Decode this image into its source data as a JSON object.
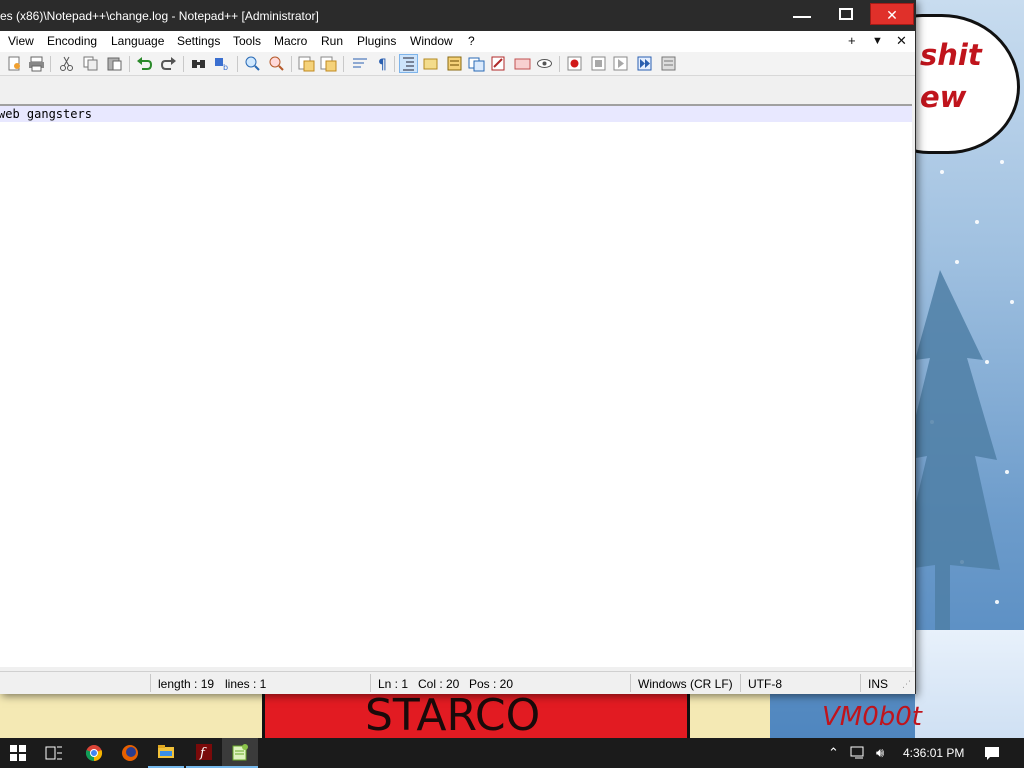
{
  "window": {
    "title": "es (x86)\\Notepad++\\change.log - Notepad++ [Administrator]"
  },
  "menu": {
    "items": [
      "View",
      "Encoding",
      "Language",
      "Settings",
      "Tools",
      "Macro",
      "Run",
      "Plugins",
      "Window",
      "?"
    ],
    "right": [
      "+",
      "▼",
      "✕"
    ]
  },
  "toolbar": {
    "icons": [
      "new-file-icon",
      "print-icon",
      "cut-icon",
      "copy-icon",
      "paste-icon",
      "undo-icon",
      "redo-icon",
      "find-icon",
      "replace-icon",
      "zoom-in-icon",
      "zoom-out-icon",
      "sync-v-icon",
      "sync-h-icon",
      "word-wrap-icon",
      "show-all-chars-icon",
      "indent-guide-icon",
      "doc-map-icon",
      "function-list-icon",
      "folder-workspace-icon",
      "monitor-icon",
      "doc-switcher-icon",
      "preview-icon",
      "record-macro-icon",
      "stop-macro-icon",
      "play-macro-icon",
      "run-macro-multiple-icon",
      "save-macro-icon"
    ]
  },
  "editor": {
    "text": "web gangsters"
  },
  "status": {
    "length": "length : 19",
    "lines": "lines : 1",
    "ln": "Ln : 1",
    "col": "Col : 20",
    "pos": "Pos : 20",
    "eol": "Windows (CR LF)",
    "encoding": "UTF-8",
    "mode": "INS"
  },
  "desktop": {
    "bubble_text_1": "shit",
    "bubble_text_2": "ew",
    "sign_text": "STARCO",
    "corner_label": "VM0b0t"
  },
  "taskbar": {
    "apps": [
      "start-icon",
      "task-view-icon",
      "chrome-icon",
      "firefox-icon",
      "file-explorer-icon",
      "flash-icon",
      "notepadpp-icon"
    ],
    "time": "4:36:01 PM"
  },
  "colors": {
    "titlebar": "#2b2b2b",
    "close_button": "#e0302a",
    "current_line": "#e8e8ff",
    "taskbar": "#1b1b1b"
  }
}
